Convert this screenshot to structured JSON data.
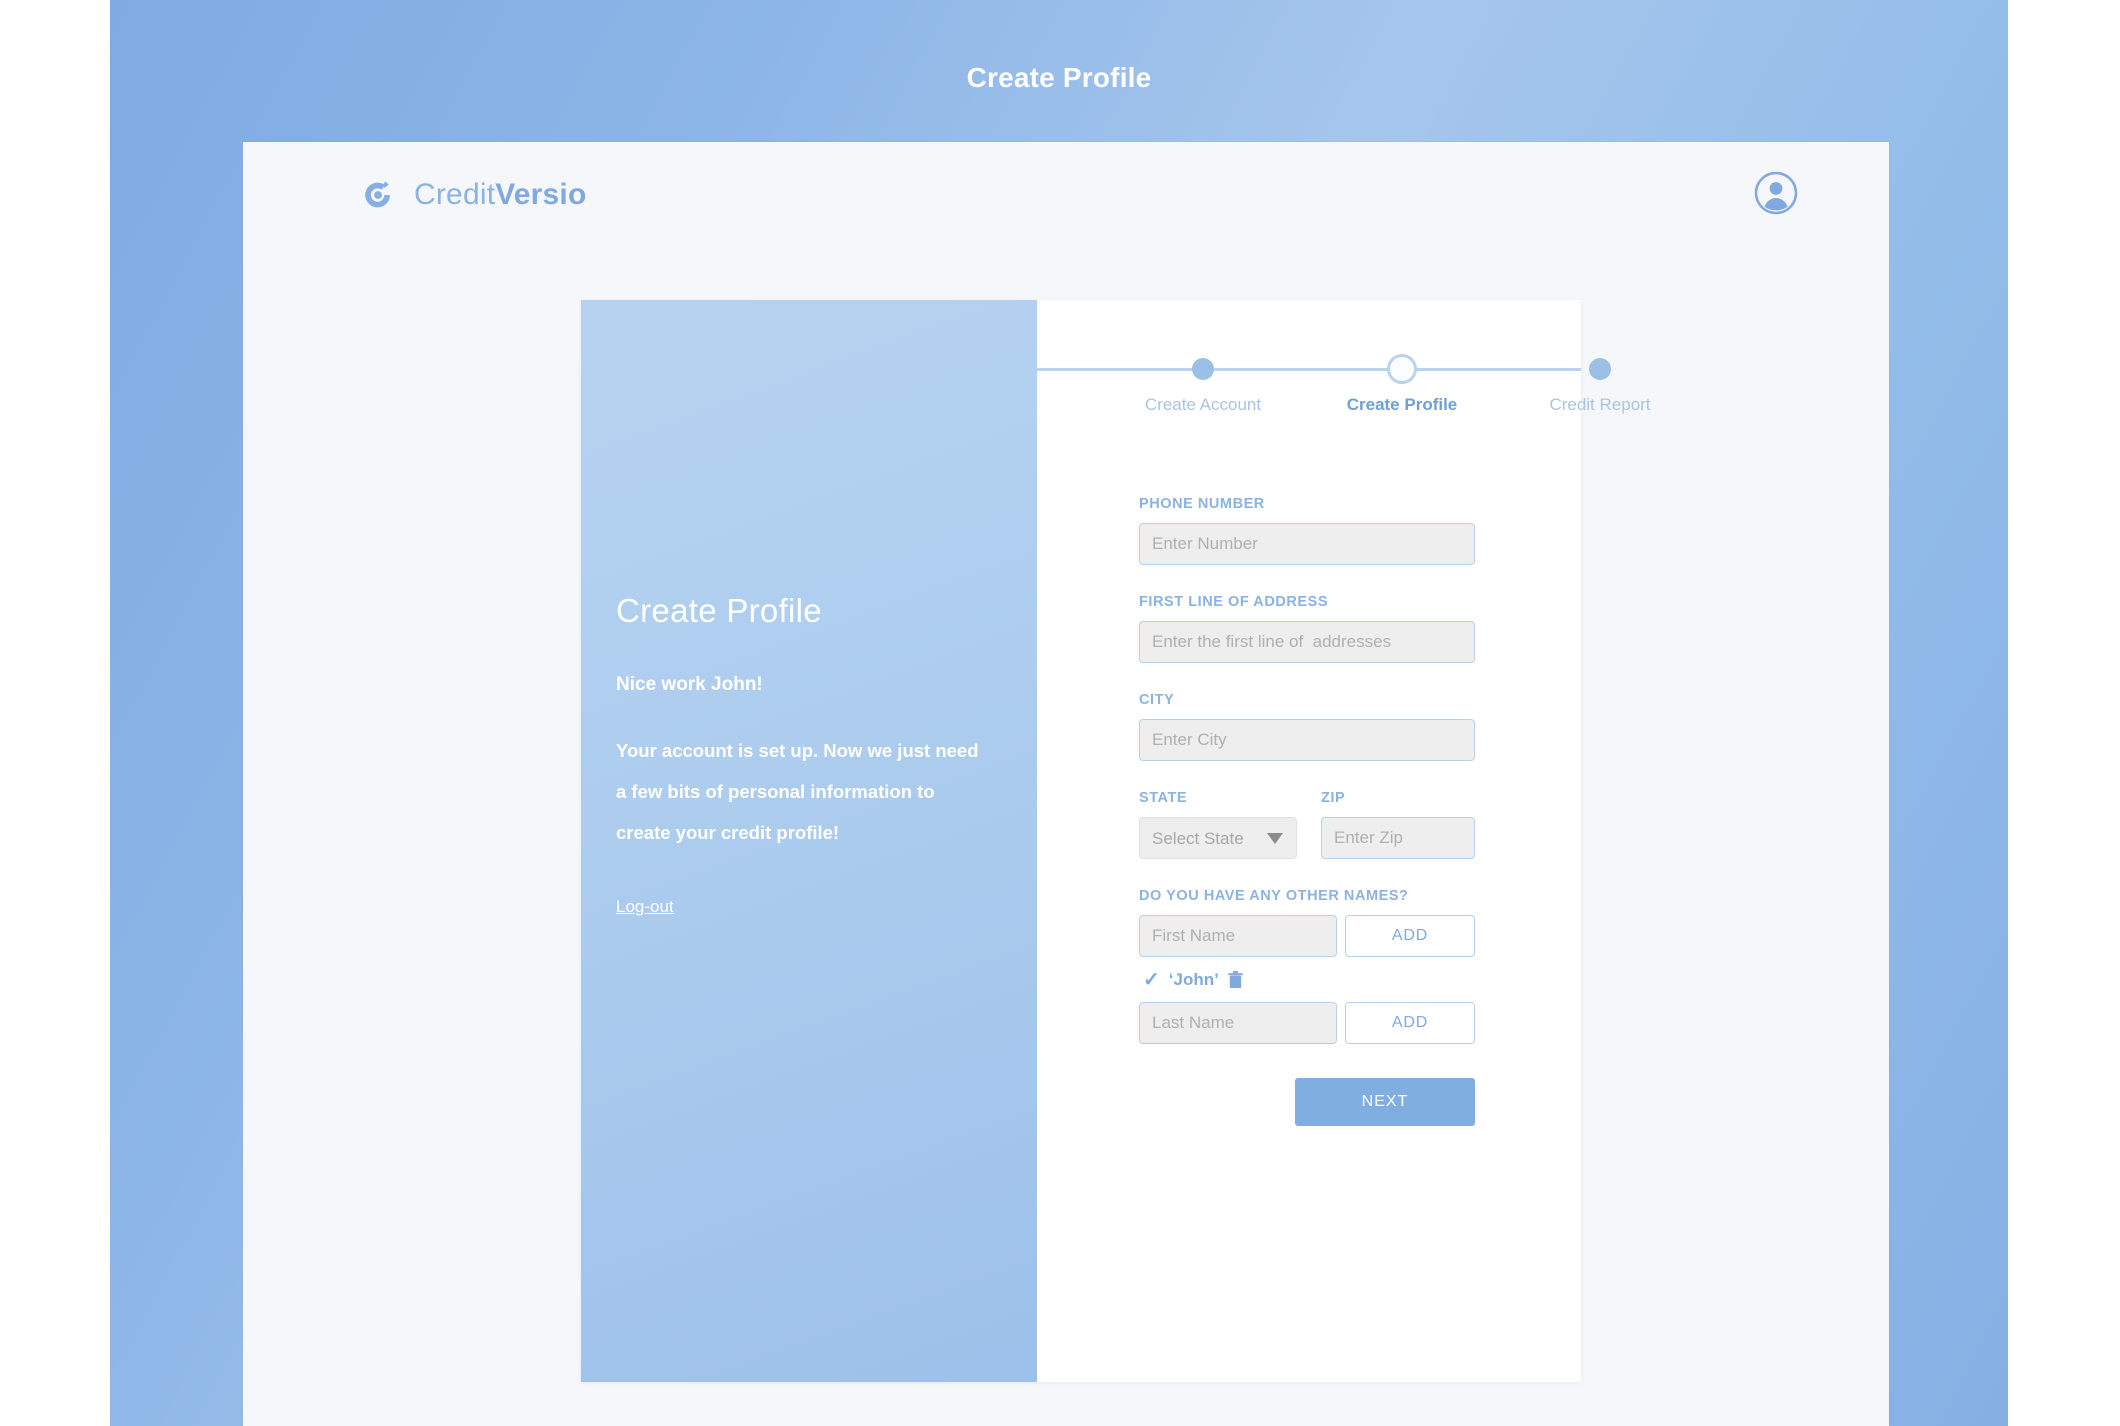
{
  "page": {
    "title": "Create Profile"
  },
  "header": {
    "brand_name_light": "Credit",
    "brand_name_bold": "Versio",
    "logo_icon": "creditversio-logo-icon",
    "account_icon": "account-avatar-icon"
  },
  "stepper": {
    "steps": [
      {
        "label": "Create Account",
        "state": "complete"
      },
      {
        "label": "Create Profile",
        "state": "active"
      },
      {
        "label": "Credit Report",
        "state": "upcoming"
      }
    ]
  },
  "left_panel": {
    "title": "Create Profile",
    "greeting": "Nice work John!",
    "body": "Your account is set up. Now we just need a few bits of personal information to create your credit profile!",
    "logout_label": "Log-out"
  },
  "form": {
    "phone": {
      "label": "PHONE NUMBER",
      "placeholder": "Enter Number",
      "value": ""
    },
    "address": {
      "label": "FIRST LINE OF ADDRESS",
      "placeholder": "Enter the first line of  addresses",
      "value": ""
    },
    "city": {
      "label": "CITY",
      "placeholder": "Enter City",
      "value": ""
    },
    "state": {
      "label": "STATE",
      "selected": "Select State",
      "caret_icon": "chevron-down-icon"
    },
    "zip": {
      "label": "ZIP",
      "placeholder": "Enter Zip",
      "value": ""
    },
    "other_names": {
      "label": "DO YOU HAVE ANY OTHER NAMES?",
      "first_name": {
        "placeholder": "First Name",
        "value": "",
        "add_label": "ADD"
      },
      "added": [
        {
          "name": "‘John’",
          "check_icon": "check-icon",
          "delete_icon": "trash-icon"
        }
      ],
      "last_name": {
        "placeholder": "Last Name",
        "value": "",
        "add_label": "ADD"
      }
    },
    "next_label": "NEXT"
  },
  "colors": {
    "brand_blue": "#7FA9DF",
    "backdrop_blue": "#8DB6E7",
    "panel_blue": "#A9CAEE",
    "input_bg": "#EEEEEE",
    "input_border": "#B6D0EC",
    "card_bg": "#F5F7FB",
    "next_button": "#81AEE0"
  }
}
